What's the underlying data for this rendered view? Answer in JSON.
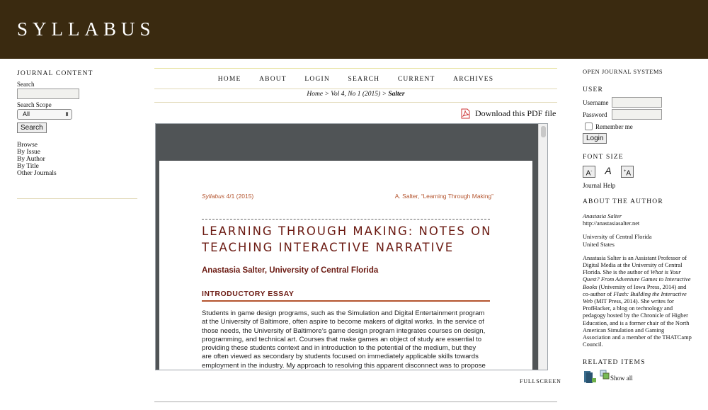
{
  "header": {
    "site_title": "SYLLABUS"
  },
  "left_sidebar": {
    "heading": "JOURNAL CONTENT",
    "search_label": "Search",
    "search_value": "",
    "scope_label": "Search Scope",
    "scope_selected": "All",
    "search_button": "Search",
    "browse_heading": "Browse",
    "browse_items": [
      "By Issue",
      "By Author",
      "By Title",
      "Other Journals"
    ]
  },
  "nav": {
    "items": [
      "HOME",
      "ABOUT",
      "LOGIN",
      "SEARCH",
      "CURRENT",
      "ARCHIVES"
    ]
  },
  "breadcrumb": {
    "home": "Home",
    "sep": " > ",
    "issue": "Vol 4, No 1 (2015)",
    "current": "Salter"
  },
  "download": {
    "label": "Download this PDF file"
  },
  "pdf": {
    "header_left_italic": "Syllabus",
    "header_left_rest": " 4/1 (2015)",
    "header_right": "A. Salter, “Learning Through Making”",
    "title_line1": "LEARNING THROUGH MAKING: NOTES ON",
    "title_line2": "TEACHING INTERACTIVE NARRATIVE",
    "author": "Anastasia Salter, University of Central Florida",
    "section": "INTRODUCTORY ESSAY",
    "body_lines": [
      "Students in game design programs, such as the Simulation and Digital Entertainment program",
      "at the University of Baltimore, often aspire to become makers of digital works. In the service of",
      "those needs, the University of Baltimore’s game design program integrates courses on design,",
      "programming, and technical art. Courses that make games an object of study are essential to",
      "providing these students context and in introduction to the potential of the medium, but they",
      "are often viewed as secondary by students focused on immediately applicable skills towards",
      "employment in the industry. My approach to resolving this apparent disconnect was to propose"
    ]
  },
  "fullscreen_label": "FULLSCREEN",
  "right_sidebar": {
    "ojs": "OPEN JOURNAL SYSTEMS",
    "user_heading": "USER",
    "username_label": "Username",
    "password_label": "Password",
    "remember_label": "Remember me",
    "login_button": "Login",
    "font_size_heading": "FONT SIZE",
    "journal_help": "Journal Help",
    "about_author_heading": "ABOUT THE AUTHOR",
    "author_name": "Anastasia Salter",
    "author_url": "http://anastasiasalter.net",
    "affiliation": "University of Central Florida",
    "country": "United States",
    "bio_lines": [
      [
        "Anastasia Salter is an Assistant Professor of"
      ],
      [
        "Digital Media at the University of Central"
      ],
      [
        "Florida. She is the author of ",
        "What is Your",
        ""
      ],
      [
        "Quest? From Adventure Games to Interactive",
        ""
      ],
      [
        "Books",
        " (University of Iowa Press, 2014) and"
      ],
      [
        "co-author of ",
        "Flash: Building the Interactive",
        ""
      ],
      [
        "Web",
        " (MIT Press, 2014). She writes for"
      ],
      [
        "ProfHacker, a blog on technology and"
      ],
      [
        "pedagogy hosted by the Chronicle of Higher"
      ],
      [
        "Education, and is a former chair of the North"
      ],
      [
        "American Simulation and Gaming"
      ],
      [
        "Association and a member of the THATCamp"
      ],
      [
        "Council."
      ]
    ],
    "related_heading": "RELATED ITEMS",
    "show_all": "Show all"
  }
}
